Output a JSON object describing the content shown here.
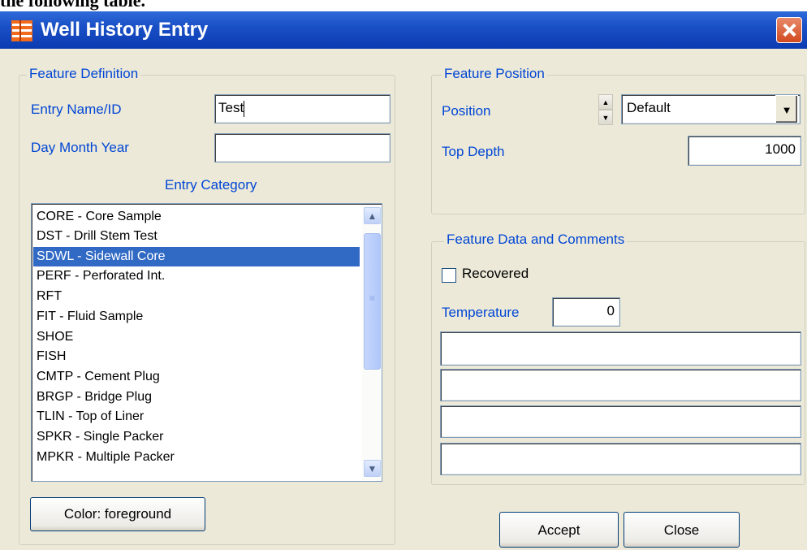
{
  "header_text": "the following table.",
  "window": {
    "title": "Well History Entry"
  },
  "feature_definition": {
    "legend": "Feature Definition",
    "entry_name_label": "Entry Name/ID",
    "entry_name_value": "Test",
    "date_label": "Day Month Year",
    "date_value": "",
    "category_label": "Entry Category",
    "categories": [
      "CORE - Core Sample",
      "DST - Drill Stem Test",
      "SDWL - Sidewall Core",
      "PERF - Perforated Int.",
      "RFT",
      "FIT - Fluid Sample",
      "SHOE",
      "FISH",
      "CMTP - Cement Plug",
      "BRGP - Bridge Plug",
      "TLIN - Top of Liner",
      "SPKR - Single Packer",
      "MPKR - Multiple Packer"
    ],
    "selected_category": "SDWL - Sidewall Core",
    "color_button": "Color:  foreground"
  },
  "feature_position": {
    "legend": "Feature Position",
    "position_label": "Position",
    "position_value": "Default",
    "top_depth_label": "Top Depth",
    "top_depth_value": "1000"
  },
  "feature_data": {
    "legend": "Feature Data and Comments",
    "recovered_label": "Recovered",
    "recovered_checked": false,
    "temperature_label": "Temperature",
    "temperature_value": "0",
    "comments": [
      "",
      "",
      "",
      ""
    ]
  },
  "buttons": {
    "accept": "Accept",
    "close": "Close"
  },
  "colors": {
    "title_bar": "#1a50c7",
    "selection": "#316ac5",
    "label_blue": "#0046d5",
    "close_red": "#d24a1e"
  }
}
